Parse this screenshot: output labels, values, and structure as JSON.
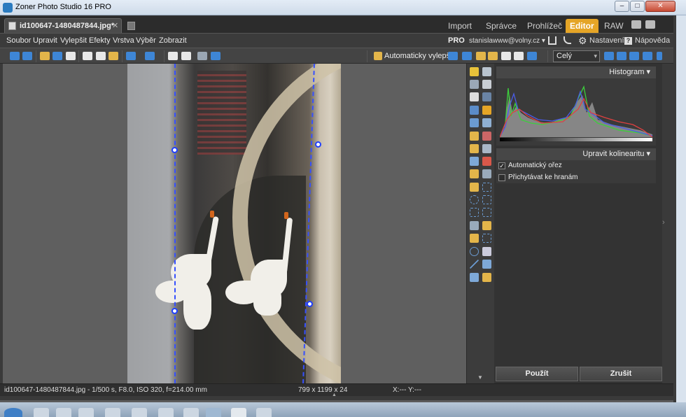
{
  "window": {
    "title": "Zoner Photo Studio 16 PRO",
    "controls": {
      "minimize": "–",
      "maximize": "□",
      "close": "✕"
    }
  },
  "tabs": {
    "document": "id100647-1480487844.jpg*",
    "close": "✕"
  },
  "modules": {
    "import": "Import",
    "spravce": "Správce",
    "prohlizec": "Prohlížeč",
    "editor": "Editor",
    "raw": "RAW",
    "active": "Editor"
  },
  "menu": {
    "soubor": "Soubor",
    "upravit": "Upravit",
    "vylepsit": "Vylepšit",
    "efekty": "Efekty",
    "vrstva": "Vrstva",
    "vyber": "Výběr",
    "zobrazit": "Zobrazit",
    "pro": "PRO",
    "account": "stanislawww@volny.cz ▾",
    "settings": "Nastavení",
    "help_icon": "?",
    "help": "Nápověda"
  },
  "toolbar": {
    "auto_enhance": "Automaticky vylepšit",
    "zoom_value": "Celý",
    "zoom_arrow": "▾"
  },
  "panel": {
    "histogram": "Histogram ▾",
    "kolinearita": "Upravit kolinearitu ▾",
    "options": [
      {
        "label": "Automatický ořez",
        "checked": true,
        "mark": "✓"
      },
      {
        "label": "Přichytávat ke hranám",
        "checked": false,
        "mark": ""
      }
    ],
    "apply": "Použít",
    "cancel": "Zrušit",
    "collapse_arrow": "›",
    "palette_arrow": "▼"
  },
  "status": {
    "file_info": "id100647-1480487844.jpg - 1/500 s, F8.0, ISO 320, f=214.00 mm",
    "dimensions": "799 x 1199 x 24",
    "coords": "X:---   Y:---",
    "grip": "▲"
  },
  "colors": {
    "accent": "#e5a526",
    "crop_line": "#3650ff",
    "panel_bg": "#333333"
  }
}
